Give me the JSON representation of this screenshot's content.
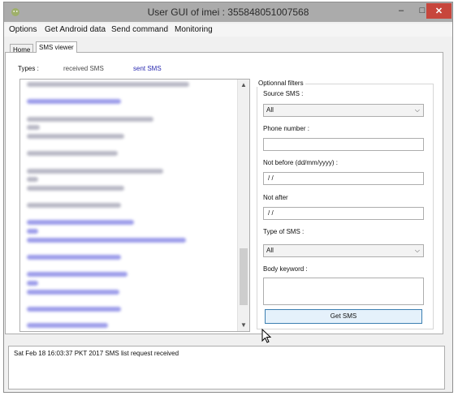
{
  "window": {
    "title": "User GUI of imei : 355848051007568"
  },
  "titlebar": {
    "icon": "android-icon",
    "min": "–",
    "max": "□",
    "close": "✕"
  },
  "menu": [
    "Options",
    "Get Android data",
    "Send command",
    "Monitoring"
  ],
  "tabs": {
    "home": "Home",
    "sms": "SMS viewer"
  },
  "types": {
    "label": "Types :",
    "received": "received SMS",
    "sent": "sent SMS"
  },
  "scroll": {
    "up": "▲",
    "down": "▼"
  },
  "filters": {
    "legend": "Optionnal filters",
    "source_label": "Source SMS :",
    "source_value": "All",
    "phone_label": "Phone number :",
    "phone_value": "",
    "not_before_label": "Not before (dd/mm/yyyy)  :",
    "not_before_value": "/ /",
    "not_after_label": "Not after",
    "not_after_value": "/ /",
    "type_label": "Type of SMS :",
    "type_value": "All",
    "keyword_label": "Body keyword :",
    "keyword_value": "",
    "chevron": "⌵",
    "button": "Get SMS"
  },
  "status": "Sat Feb 18 16:03:37 PKT 2017 SMS list request received",
  "colors": {
    "received": "#4a4a4a",
    "sent": "#2a2ab0",
    "blur_gray": "#b9b9c6",
    "blur_blue": "#9d9dea"
  }
}
